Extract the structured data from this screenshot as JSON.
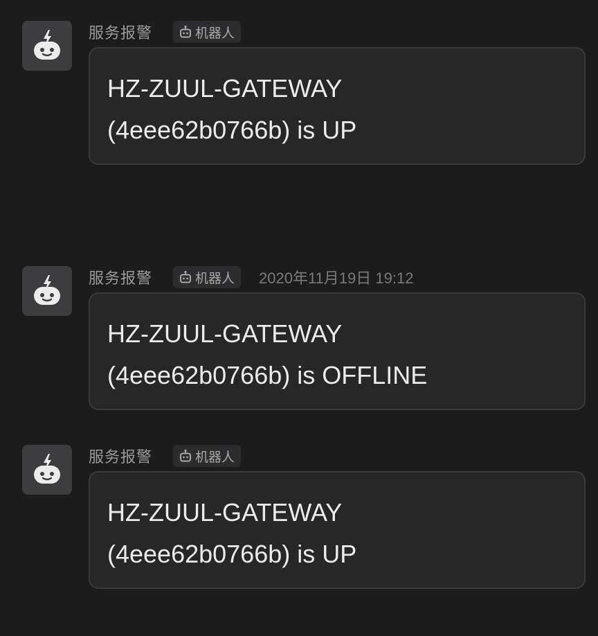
{
  "messages": [
    {
      "sender": "服务报警",
      "tag": "机器人",
      "timestamp": "",
      "text": "HZ-ZUUL-GATEWAY\n(4eee62b0766b) is UP"
    },
    {
      "sender": "服务报警",
      "tag": "机器人",
      "timestamp": "2020年11月19日 19:12",
      "text": "HZ-ZUUL-GATEWAY\n(4eee62b0766b) is OFFLINE"
    },
    {
      "sender": "服务报警",
      "tag": "机器人",
      "timestamp": "",
      "text": "HZ-ZUUL-GATEWAY\n(4eee62b0766b) is UP"
    }
  ],
  "icons": {
    "avatar": "robot-icon",
    "tag": "robot-icon"
  },
  "colors": {
    "background": "#1c1c1c",
    "bubble": "#272727",
    "bubble_border": "#3a3a3c",
    "avatar_bg": "#3d3d3f",
    "avatar_fg": "#ececec"
  }
}
